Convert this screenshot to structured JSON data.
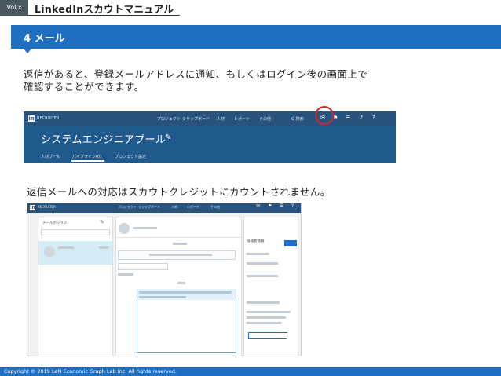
{
  "header": {
    "vol_badge": "Vol.x",
    "doc_title": "LinkedInスカウトマニュアル"
  },
  "section": {
    "title": "4 メール"
  },
  "body": {
    "line1": "返信があると、登録メールアドレスに通知、もしくはログイン後の画面上で",
    "line2": "確認することができます。",
    "line3": "返信メールへの対応はスカウトクレジットにカウントされません。"
  },
  "screenshot1": {
    "logo": "in",
    "brand": "RECRUITER",
    "nav_items": [
      "プロジェクト",
      "クリップボード",
      "人材",
      "レポート",
      "その他"
    ],
    "search_label": "Q 検索",
    "project_title": "システムエンジニアプール",
    "tabs": [
      "人材プール",
      "パイプライン(0)",
      "プロジェクト設定"
    ],
    "icons": [
      "mail-icon",
      "flag-icon",
      "list-icon",
      "bell-icon",
      "help-icon"
    ]
  },
  "screenshot2": {
    "logo": "in",
    "brand": "RECRUITER",
    "nav_items": [
      "プロジェクト",
      "クリップボード",
      "人材",
      "レポート",
      "その他"
    ],
    "left_header": "メールボックス",
    "right_header": "候補者情報",
    "colors": {
      "nav": "#27537d",
      "accent": "#1e6fc1",
      "selected_row": "#d6ecf4",
      "reply_border": "#6fa8d6"
    }
  },
  "footer": {
    "copyright": "Copyright © 2019 LeN Economic Graph Lab Inc. All rights reserved."
  },
  "colors": {
    "primary": "#1e6fc1",
    "badge": "#4a5862",
    "highlight": "#d0282c"
  }
}
